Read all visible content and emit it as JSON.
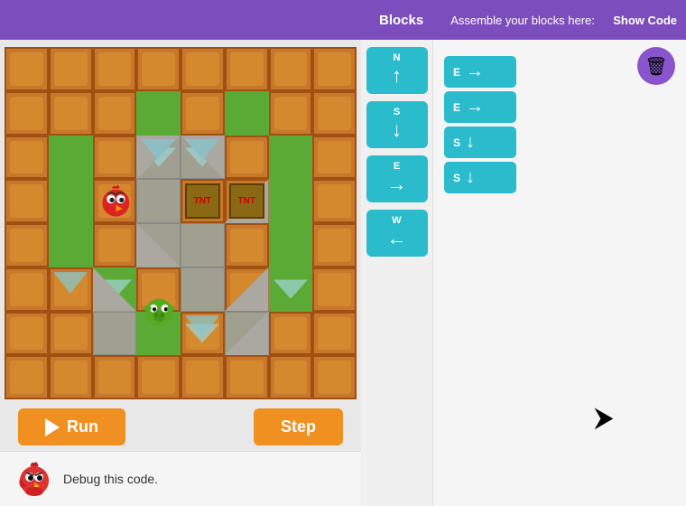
{
  "header": {
    "blocks_label": "Blocks",
    "assemble_label": "Assemble your blocks here:",
    "show_code_label": "Show Code"
  },
  "controls": {
    "run_label": "Run",
    "step_label": "Step"
  },
  "debug": {
    "text": "Debug this code."
  },
  "palette_blocks": [
    {
      "id": "north",
      "label": "N",
      "arrow": "↑"
    },
    {
      "id": "south",
      "label": "S",
      "arrow": "↓"
    },
    {
      "id": "east",
      "label": "E",
      "arrow": "→"
    },
    {
      "id": "west",
      "label": "W",
      "arrow": "←"
    }
  ],
  "assembled_blocks": [
    {
      "id": "e1",
      "label": "E",
      "arrow": "→"
    },
    {
      "id": "e2",
      "label": "E",
      "arrow": "→"
    },
    {
      "id": "s1",
      "label": "S",
      "arrow": "↓"
    },
    {
      "id": "s2",
      "label": "S",
      "arrow": "↓"
    }
  ],
  "trash": {
    "icon": "🗑",
    "label": "delete"
  }
}
